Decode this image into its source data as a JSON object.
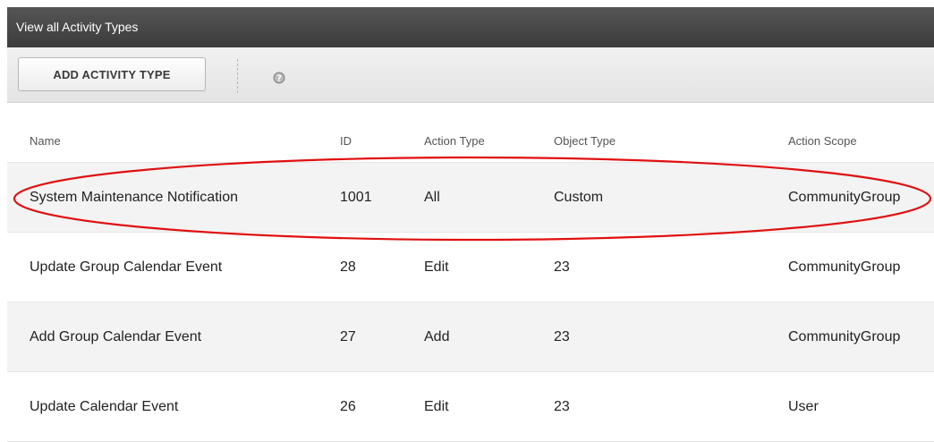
{
  "window": {
    "title": "View all Activity Types"
  },
  "toolbar": {
    "add_label": "ADD ACTIVITY TYPE",
    "help_icon": "help-icon"
  },
  "table": {
    "columns": [
      "Name",
      "ID",
      "Action Type",
      "Object Type",
      "Action Scope"
    ],
    "rows": [
      {
        "name": "System Maintenance Notification",
        "id": "1001",
        "action_type": "All",
        "object_type": "Custom",
        "action_scope": "CommunityGroup"
      },
      {
        "name": "Update Group Calendar Event",
        "id": "28",
        "action_type": "Edit",
        "object_type": "23",
        "action_scope": "CommunityGroup"
      },
      {
        "name": "Add Group Calendar Event",
        "id": "27",
        "action_type": "Add",
        "object_type": "23",
        "action_scope": "CommunityGroup"
      },
      {
        "name": "Update Calendar Event",
        "id": "26",
        "action_type": "Edit",
        "object_type": "23",
        "action_scope": "User"
      }
    ]
  },
  "annotation": {
    "color": "#e01010"
  }
}
